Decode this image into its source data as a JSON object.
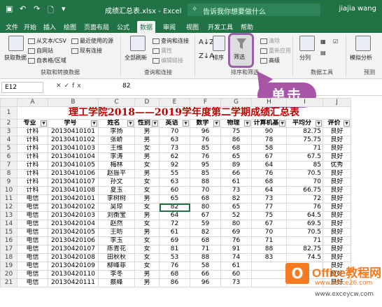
{
  "colors": {
    "accent": "#217346",
    "callout": "#a855a8",
    "title_red": "#c00000",
    "watermark": "#f47b20"
  },
  "titlebar": {
    "filename": "成绩汇总表.xlsx - Excel",
    "search_placeholder": "告诉我你想要做什么",
    "user": "jiajia wang"
  },
  "tabs": [
    "文件",
    "开始",
    "插入",
    "绘图",
    "页面布局",
    "公式",
    "数据",
    "审阅",
    "视图",
    "开发工具",
    "帮助"
  ],
  "ribbon": {
    "get_data": "获取数据",
    "from_text": "从文本/CSV",
    "from_web": "自网站",
    "from_table": "自表格/区域",
    "recent_sources": "最近使用的源",
    "existing_conn": "现有连接",
    "group_get": "获取和转换数据",
    "refresh_all": "全部刷新",
    "queries_conn": "查询和连接",
    "properties": "属性",
    "edit_links": "编辑链接",
    "group_query": "查询和连接",
    "sort": "排序",
    "filter": "筛选",
    "clear": "清除",
    "reapply": "重新应用",
    "advanced": "高级",
    "group_sort": "排序和筛选",
    "split": "分列",
    "group_tools": "数据工具",
    "whatif": "模拟分析",
    "group_forecast": "预测"
  },
  "callout": "单击",
  "formula_bar": {
    "cell": "E12",
    "value": "82"
  },
  "sheet": {
    "columns": [
      "A",
      "B",
      "C",
      "D",
      "E",
      "F",
      "G",
      "H",
      "I",
      "J"
    ],
    "title": "理工学院2018——2019学年度第二学期成绩汇总表",
    "headers": [
      "专业",
      "学号",
      "姓名",
      "性别",
      "英语",
      "数学",
      "物理",
      "计算机基",
      "平均分",
      "评价"
    ],
    "rows": [
      [
        "计科",
        "20130410101",
        "李扬",
        "男",
        "70",
        "96",
        "75",
        "90",
        "82.75",
        "良好"
      ],
      [
        "计科",
        "20130410102",
        "张峤",
        "男",
        "63",
        "76",
        "86",
        "78",
        "75.75",
        "良好"
      ],
      [
        "计科",
        "20130410103",
        "王维",
        "女",
        "73",
        "85",
        "68",
        "58",
        "71",
        "良好"
      ],
      [
        "计科",
        "20130410104",
        "李涛",
        "男",
        "62",
        "76",
        "65",
        "67",
        "67.5",
        "良好"
      ],
      [
        "计科",
        "20130410105",
        "梅林",
        "女",
        "92",
        "95",
        "89",
        "64",
        "85",
        "优秀"
      ],
      [
        "计科",
        "20130410106",
        "赵振平",
        "男",
        "55",
        "85",
        "66",
        "76",
        "70.5",
        "良好"
      ],
      [
        "计科",
        "20130410107",
        "孙文",
        "女",
        "63",
        "88",
        "61",
        "68",
        "70",
        "良好"
      ],
      [
        "计科",
        "20130410108",
        "夏玉",
        "女",
        "60",
        "70",
        "73",
        "64",
        "66.75",
        "良好"
      ],
      [
        "电信",
        "20130420101",
        "李树树",
        "男",
        "65",
        "68",
        "82",
        "73",
        "72",
        "良好"
      ],
      [
        "电信",
        "20130420102",
        "吴琼",
        "女",
        "82",
        "80",
        "65",
        "77",
        "76",
        "良好"
      ],
      [
        "电信",
        "20130420103",
        "刘衡宝",
        "男",
        "64",
        "67",
        "52",
        "75",
        "64.5",
        "良好"
      ],
      [
        "电信",
        "20130420104",
        "赵然",
        "女",
        "72",
        "59",
        "80",
        "67",
        "69.5",
        "良好"
      ],
      [
        "电信",
        "20130420105",
        "王昉",
        "男",
        "61",
        "82",
        "69",
        "70",
        "70.5",
        "良好"
      ],
      [
        "电信",
        "20130420106",
        "李玉",
        "女",
        "69",
        "68",
        "76",
        "71",
        "71",
        "良好"
      ],
      [
        "电信",
        "20130420107",
        "陈青花",
        "女",
        "81",
        "71",
        "91",
        "88",
        "82.75",
        "良好"
      ],
      [
        "电信",
        "20130420108",
        "田秋秋",
        "女",
        "53",
        "88",
        "74",
        "83",
        "74.5",
        "良好"
      ],
      [
        "电信",
        "20130420109",
        "柳峰菲",
        "女",
        "76",
        "58",
        "61",
        "",
        "",
        "良好"
      ],
      [
        "电信",
        "20130420110",
        "李冬",
        "男",
        "68",
        "66",
        "60",
        "",
        "",
        "良好"
      ],
      [
        "电信",
        "20130420111",
        "蔡峰",
        "男",
        "86",
        "96",
        "73",
        "",
        "",
        "良好"
      ]
    ]
  },
  "watermark": {
    "brand": "Office教程网",
    "url1": "www.office26.com",
    "url2": "www.exceycw.com"
  }
}
